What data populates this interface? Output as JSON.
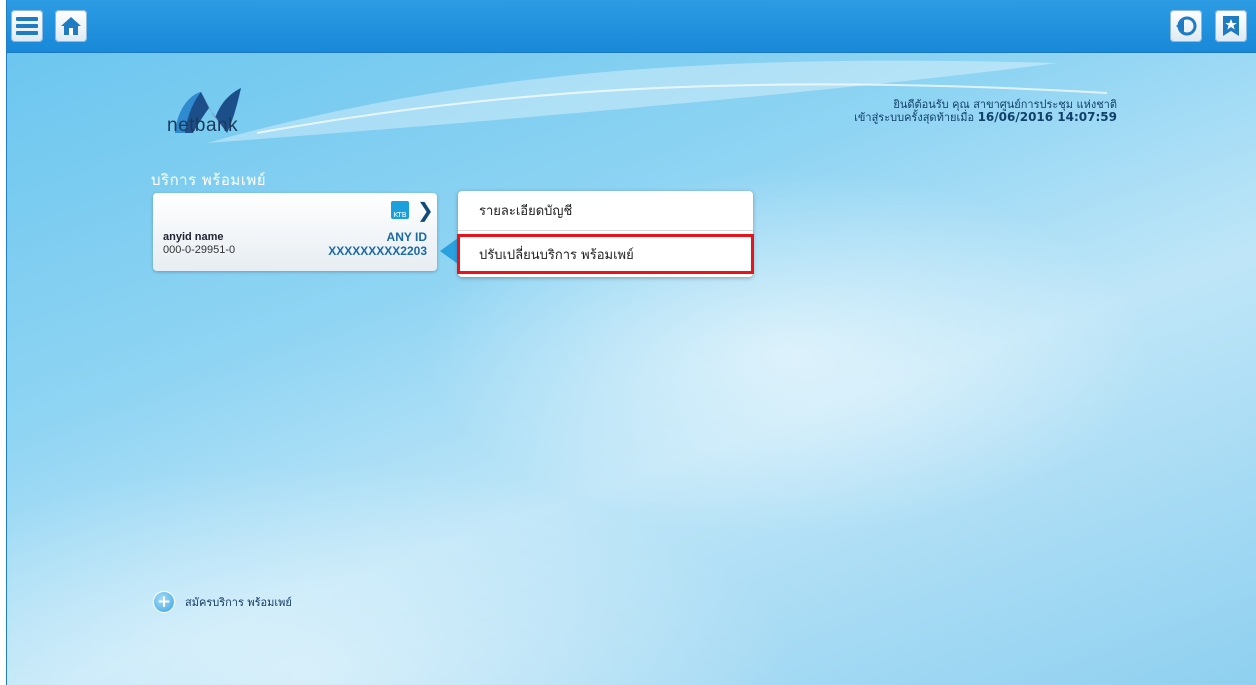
{
  "topbar": {
    "icons": [
      "menu-icon",
      "home-icon",
      "logout-icon",
      "bookmark-icon"
    ]
  },
  "brand": {
    "logo_text": "netbank",
    "logo_small": "KTB"
  },
  "welcome": {
    "line1": "ยินดีต้อนรับ คุณ สาขาศูนย์การประชุม แห่งชาติ",
    "line2_prefix": "เข้าสู่ระบบครั้งสุดท้ายเมื่อ",
    "line2_timestamp": "16/06/2016 14:07:59"
  },
  "section": {
    "title": "บริการ พร้อมเพย์"
  },
  "account_card": {
    "bank_icon_label": "KTB",
    "name": "anyid name",
    "number": "000-0-29951-0",
    "type_label": "ANY ID",
    "anyid_value": "XXXXXXXXX2203"
  },
  "menu": {
    "items": [
      {
        "label": "รายละเอียดบัญชี"
      },
      {
        "label": "ปรับเปลี่ยนบริการ พร้อมเพย์"
      }
    ],
    "highlight_color": "#e8131b"
  },
  "register": {
    "label": "สมัครบริการ พร้อมเพย์"
  },
  "colors": {
    "topbar": "#1888d8",
    "accent": "#1a6aa6"
  }
}
